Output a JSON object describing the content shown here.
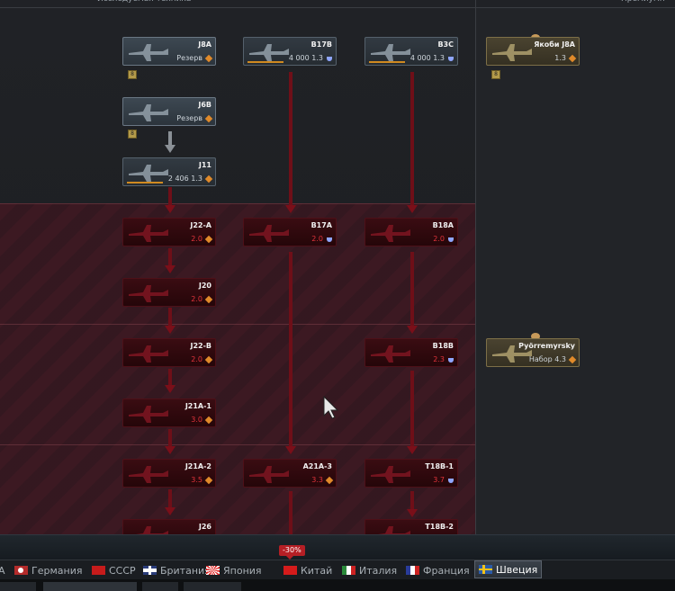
{
  "headers": {
    "researched": "Исследуемая техника",
    "premium": "Премиумн"
  },
  "vehicles": [
    {
      "id": "j8a",
      "name": "J8A",
      "status": "Резерв",
      "rating": "",
      "rating_type": "orange",
      "state": "unlocked"
    },
    {
      "id": "b17b",
      "name": "B17B",
      "status": "4 000",
      "rating": "1.3",
      "rating_type": "blue",
      "state": "avail"
    },
    {
      "id": "b3c",
      "name": "B3C",
      "status": "4 000",
      "rating": "1.3",
      "rating_type": "blue",
      "state": "avail"
    },
    {
      "id": "jakobi",
      "name": "Якоби J8A",
      "status": "",
      "rating": "1.3",
      "rating_type": "orange",
      "state": "prem"
    },
    {
      "id": "j6b",
      "name": "J6B",
      "status": "Резерв",
      "rating": "",
      "rating_type": "orange",
      "state": "unlocked"
    },
    {
      "id": "j11",
      "name": "J11",
      "status": "2 406",
      "rating": "1.3",
      "rating_type": "orange",
      "state": "avail"
    },
    {
      "id": "j22a",
      "name": "J22-A",
      "status": "",
      "rating": "2.0",
      "rating_type": "orange",
      "state": "locked"
    },
    {
      "id": "b17a",
      "name": "B17A",
      "status": "",
      "rating": "2.0",
      "rating_type": "blue",
      "state": "locked"
    },
    {
      "id": "b18a",
      "name": "B18A",
      "status": "",
      "rating": "2.0",
      "rating_type": "blue",
      "state": "locked"
    },
    {
      "id": "j20",
      "name": "J20",
      "status": "",
      "rating": "2.0",
      "rating_type": "orange",
      "state": "locked"
    },
    {
      "id": "j22b",
      "name": "J22-B",
      "status": "",
      "rating": "2.0",
      "rating_type": "orange",
      "state": "locked"
    },
    {
      "id": "b18b",
      "name": "B18B",
      "status": "",
      "rating": "2.3",
      "rating_type": "blue",
      "state": "locked"
    },
    {
      "id": "pyorremyrsky",
      "name": "Pyörremyrsky",
      "status": "Набор",
      "rating": "4.3",
      "rating_type": "orange",
      "state": "prem"
    },
    {
      "id": "j21a1",
      "name": "J21A-1",
      "status": "",
      "rating": "3.0",
      "rating_type": "orange",
      "state": "locked"
    },
    {
      "id": "j21a2",
      "name": "J21A-2",
      "status": "",
      "rating": "3.5",
      "rating_type": "orange",
      "state": "locked"
    },
    {
      "id": "a21a3",
      "name": "A21A-3",
      "status": "",
      "rating": "3.3",
      "rating_type": "orange",
      "state": "locked"
    },
    {
      "id": "t18b1",
      "name": "T18B-1",
      "status": "",
      "rating": "3.7",
      "rating_type": "blue",
      "state": "locked"
    },
    {
      "id": "j26",
      "name": "J26",
      "status": "",
      "rating": "",
      "rating_type": "orange",
      "state": "locked"
    },
    {
      "id": "t18b2",
      "name": "T18B-2",
      "status": "",
      "rating": "",
      "rating_type": "blue",
      "state": "locked"
    }
  ],
  "discount_badge": "-30%",
  "nations": [
    {
      "id": "a",
      "label": "А"
    },
    {
      "id": "germany",
      "label": "Германия"
    },
    {
      "id": "ussr",
      "label": "СССР"
    },
    {
      "id": "britain",
      "label": "Британия"
    },
    {
      "id": "japan",
      "label": "Япония"
    },
    {
      "id": "china",
      "label": "Китай"
    },
    {
      "id": "italy",
      "label": "Италия"
    },
    {
      "id": "france",
      "label": "Франция"
    },
    {
      "id": "sweden",
      "label": "Швеция"
    }
  ],
  "colors": {
    "locked": "#e0333b",
    "accent": "#e08a2a",
    "blue_rank": "#8fa6ff"
  }
}
